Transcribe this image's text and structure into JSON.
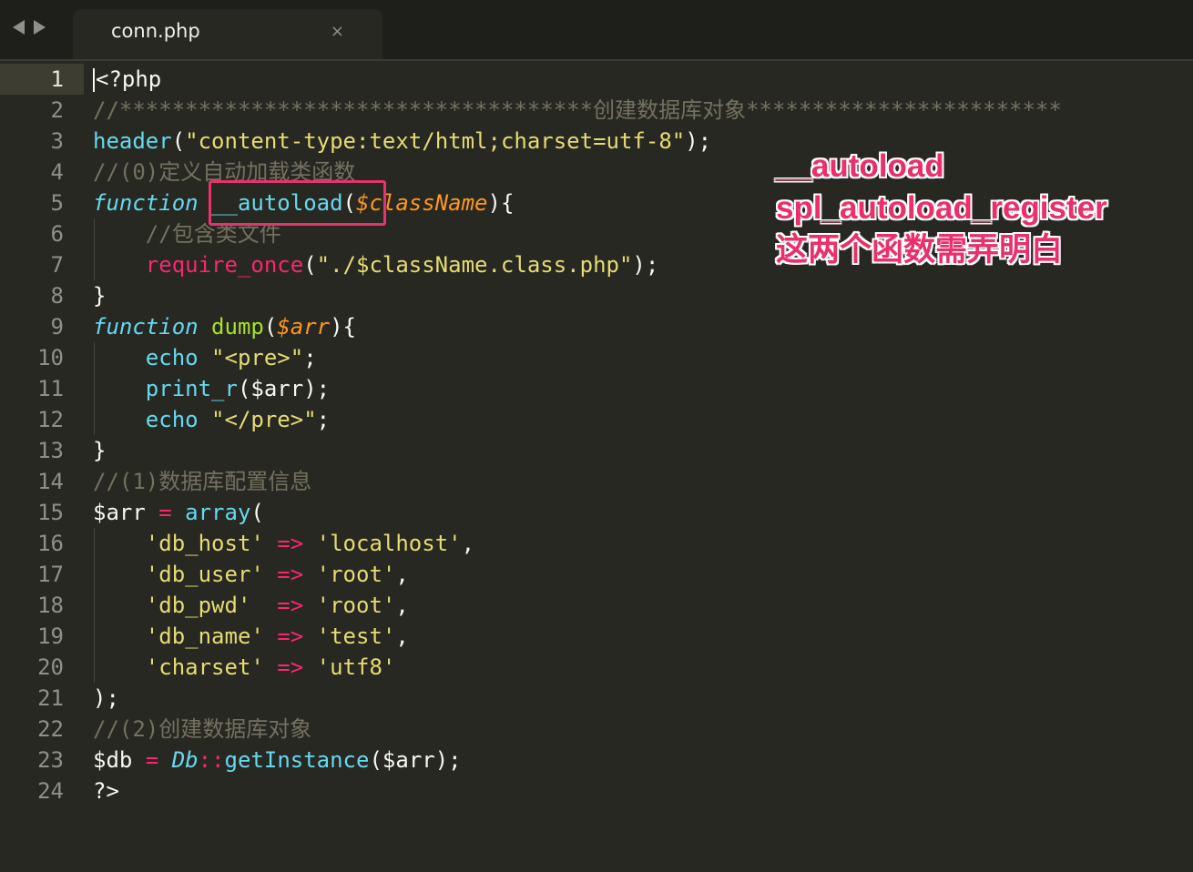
{
  "tab": {
    "filename": "conn.php",
    "close_glyph": "×"
  },
  "gutter": [
    "1",
    "2",
    "3",
    "4",
    "5",
    "6",
    "7",
    "8",
    "9",
    "10",
    "11",
    "12",
    "13",
    "14",
    "15",
    "16",
    "17",
    "18",
    "19",
    "20",
    "21",
    "22",
    "23",
    "24"
  ],
  "code": {
    "l1_a": "<?php",
    "l2": "//************************************创建数据库对象************************",
    "l3_a": "header",
    "l3_b": "(",
    "l3_c": "\"content-type:text/html;charset=utf-8\"",
    "l3_d": ");",
    "l4": "//(0)定义自动加载类函数",
    "l5_a": "function",
    "l5_b": " ",
    "l5_c": "__autoload",
    "l5_d": "(",
    "l5_e": "$className",
    "l5_f": "){",
    "l6": "    //包含类文件",
    "l7_a": "    ",
    "l7_b": "require_once",
    "l7_c": "(",
    "l7_d": "\"./$className.class.php\"",
    "l7_e": ");",
    "l8": "}",
    "l9_a": "function",
    "l9_b": " ",
    "l9_c": "dump",
    "l9_d": "(",
    "l9_e": "$arr",
    "l9_f": "){",
    "l10_a": "    ",
    "l10_b": "echo",
    "l10_c": " ",
    "l10_d": "\"<pre>\"",
    "l10_e": ";",
    "l11_a": "    ",
    "l11_b": "print_r",
    "l11_c": "($arr);",
    "l12_a": "    ",
    "l12_b": "echo",
    "l12_c": " ",
    "l12_d": "\"</pre>\"",
    "l12_e": ";",
    "l13": "}",
    "l14": "//(1)数据库配置信息",
    "l15_a": "$arr ",
    "l15_b": "=",
    "l15_c": " ",
    "l15_d": "array",
    "l15_e": "(",
    "l16_a": "    ",
    "l16_b": "'db_host'",
    "l16_c": " ",
    "l16_d": "=>",
    "l16_e": " ",
    "l16_f": "'localhost'",
    "l16_g": ",",
    "l17_a": "    ",
    "l17_b": "'db_user'",
    "l17_c": " ",
    "l17_d": "=>",
    "l17_e": " ",
    "l17_f": "'root'",
    "l17_g": ",",
    "l18_a": "    ",
    "l18_b": "'db_pwd'",
    "l18_c": "  ",
    "l18_d": "=>",
    "l18_e": " ",
    "l18_f": "'root'",
    "l18_g": ",",
    "l19_a": "    ",
    "l19_b": "'db_name'",
    "l19_c": " ",
    "l19_d": "=>",
    "l19_e": " ",
    "l19_f": "'test'",
    "l19_g": ",",
    "l20_a": "    ",
    "l20_b": "'charset'",
    "l20_c": " ",
    "l20_d": "=>",
    "l20_e": " ",
    "l20_f": "'utf8'",
    "l21": ");",
    "l22": "//(2)创建数据库对象",
    "l23_a": "$db ",
    "l23_b": "=",
    "l23_c": " ",
    "l23_d": "Db",
    "l23_e": "::",
    "l23_f": "getInstance",
    "l23_g": "($arr);",
    "l24": "?>"
  },
  "annotation": {
    "line1": "__autoload",
    "line2": "spl_autoload_register",
    "line3": "这两个函数需弄明白"
  },
  "colors": {
    "background": "#272822",
    "comment": "#75715e",
    "keyword": "#f92672",
    "string": "#e6db74",
    "function": "#a6e22e",
    "builtin": "#66d9ef",
    "parameter": "#fd971f",
    "annotation": "#ea2f6a"
  }
}
